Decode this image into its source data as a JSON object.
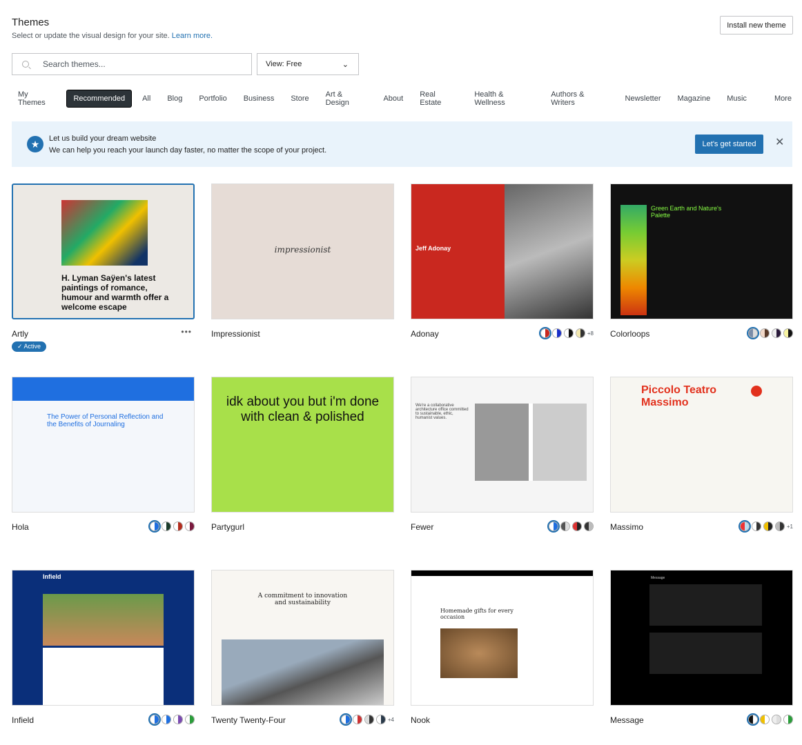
{
  "header": {
    "title": "Themes",
    "subtitle": "Select or update the visual design for your site.",
    "learn_more": "Learn more.",
    "install_button": "Install new theme"
  },
  "search": {
    "placeholder": "Search themes..."
  },
  "view_select": {
    "value": "View: Free"
  },
  "tabs": [
    "My Themes",
    "Recommended",
    "All",
    "Blog",
    "Portfolio",
    "Business",
    "Store",
    "Art & Design",
    "About",
    "Real Estate",
    "Health & Wellness",
    "Authors & Writers",
    "Newsletter",
    "Magazine",
    "Music",
    "More"
  ],
  "active_tab": "Recommended",
  "banner": {
    "title": "Let us build your dream website",
    "text": "We can help you reach your launch day faster, no matter the scope of your project.",
    "cta": "Let's get started"
  },
  "accent": "#2271b1",
  "themes": [
    {
      "name": "Artly",
      "active": true,
      "badge": "✓ Active",
      "preview": "H. Lyman Saÿen's latest paintings of romance, humour and warmth offer a welcome escape",
      "bg": "#ece9e4",
      "swatches": [],
      "extra": ""
    },
    {
      "name": "Impressionist",
      "preview": "impressionist",
      "bg": "#e6dcd6",
      "swatches": [],
      "extra": ""
    },
    {
      "name": "Adonay",
      "preview": "Jeff Adonay",
      "bg": "#c9281f",
      "swatches": [
        [
          "#fff",
          "#c9281f"
        ],
        [
          "#fff",
          "#1a2fc8"
        ],
        [
          "#fff",
          "#111"
        ],
        [
          "#f3e8b0",
          "#333"
        ]
      ],
      "extra": "+8"
    },
    {
      "name": "Colorloops",
      "preview": "Green Earth and Nature's Palette",
      "bg": "#111",
      "swatches": [
        [
          "#7a8ca8",
          "#ddd"
        ],
        [
          "#f2d9c9",
          "#5a3a2a"
        ],
        [
          "#eee",
          "#2a1a3a"
        ],
        [
          "#f7f3a0",
          "#111"
        ]
      ],
      "extra": ""
    },
    {
      "name": "Hola",
      "preview": "The Power of Personal Reflection and the Benefits of Journaling",
      "bg": "#f4f7fb",
      "swatches": [
        [
          "#fff",
          "#1f6fe0"
        ],
        [
          "#fff",
          "#1c3b2a"
        ],
        [
          "#fff",
          "#b32d1e"
        ],
        [
          "#fff",
          "#7a1a3e"
        ]
      ],
      "extra": ""
    },
    {
      "name": "Partygurl",
      "preview": "idk about you but i'm done with clean & polished",
      "bg": "#a8e04a",
      "swatches": [],
      "extra": ""
    },
    {
      "name": "Fewer",
      "preview": "We're a collaborative architecture office committed to sustainable, ethic, humanist values.",
      "bg": "#f5f5f5",
      "swatches": [
        [
          "#fff",
          "#1f6fe0"
        ],
        [
          "#555",
          "#ddd"
        ],
        [
          "#d33",
          "#222"
        ],
        [
          "#333",
          "#bbb"
        ]
      ],
      "extra": ""
    },
    {
      "name": "Massimo",
      "preview": "Piccolo Teatro Massimo",
      "bg": "#f7f6f1",
      "swatches": [
        [
          "#e33",
          "#bde"
        ],
        [
          "#fff",
          "#333"
        ],
        [
          "#f0c000",
          "#222"
        ],
        [
          "#bbb",
          "#333"
        ]
      ],
      "extra": "+1"
    },
    {
      "name": "Infield",
      "preview": "Infield",
      "bg": "#0a2f7a",
      "swatches": [
        [
          "#fff",
          "#1f6fe0"
        ],
        [
          "#fff",
          "#1f6fe0"
        ],
        [
          "#fff",
          "#7a4ab0"
        ],
        [
          "#fff",
          "#2a9d3a"
        ]
      ],
      "extra": ""
    },
    {
      "name": "Twenty Twenty-Four",
      "preview": "A commitment to innovation and sustainability",
      "bg": "#f8f6f2",
      "swatches": [
        [
          "#fff",
          "#1f6fe0"
        ],
        [
          "#fff",
          "#c33"
        ],
        [
          "#ddd",
          "#333"
        ],
        [
          "#fff",
          "#2a3a4a"
        ]
      ],
      "extra": "+4"
    },
    {
      "name": "Nook",
      "preview": "Homemade gifts for every occasion",
      "bg": "#fff",
      "swatches": [],
      "extra": ""
    },
    {
      "name": "Message",
      "preview": "Message",
      "bg": "#000",
      "swatches": [
        [
          "#111",
          "#fff"
        ],
        [
          "#f0c000",
          "#fff"
        ],
        [
          "#eee",
          "#ddd"
        ],
        [
          "#fff",
          "#2a9d3a"
        ]
      ],
      "extra": ""
    }
  ]
}
